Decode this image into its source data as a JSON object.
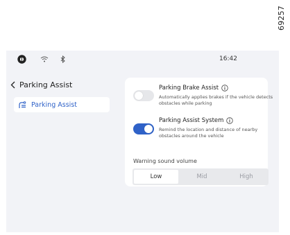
{
  "figure_id": "69257",
  "status_bar": {
    "time": "16:42",
    "icons": [
      "profile-icon",
      "wifi-icon",
      "bluetooth-icon"
    ]
  },
  "nav": {
    "back_label": "Parking Assist",
    "items": [
      {
        "label": "Parking Assist",
        "icon": "parking-assist-icon"
      }
    ]
  },
  "settings": {
    "parking_brake_assist": {
      "title": "Parking Brake Assist",
      "description": "Automatically applies brakes if the vehicle detects obstacles while parking",
      "enabled": false
    },
    "parking_assist_system": {
      "title": "Parking Assist System",
      "description": "Remind the location and distance of nearby obstacles around the vehicle",
      "enabled": true
    },
    "warning_sound": {
      "label": "Warning sound volume",
      "options": [
        "Low",
        "Mid",
        "High"
      ],
      "selected": "Low"
    }
  },
  "colors": {
    "accent": "#2f62c8",
    "panel_bg": "#f2f3f7",
    "card_bg": "#ffffff",
    "toggle_off": "#e6e7ea"
  }
}
